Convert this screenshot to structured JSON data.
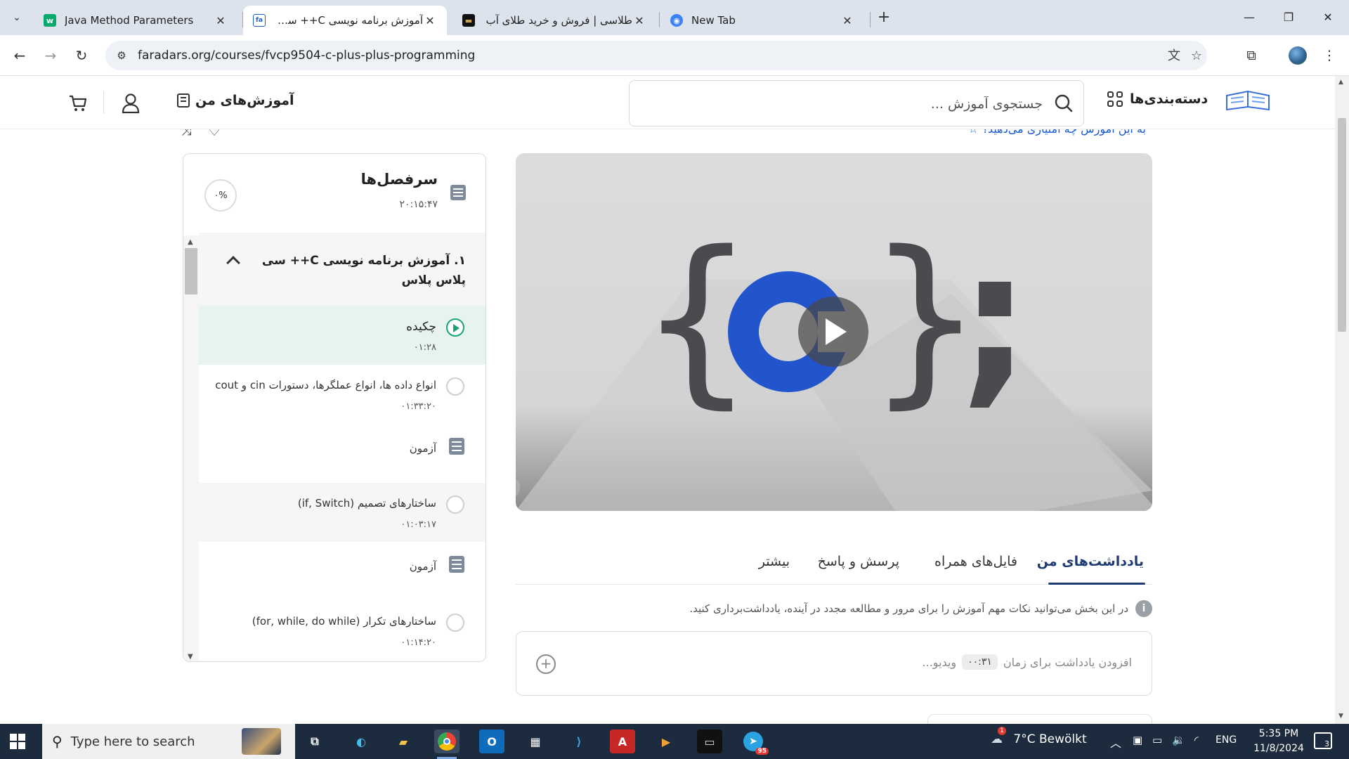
{
  "browser": {
    "tabs": [
      {
        "title": "Java Method Parameters",
        "favicon": "w3"
      },
      {
        "title": "آموزش برنامه نویسی C++ سی پلاس",
        "favicon": "faradars"
      },
      {
        "title": "طلاسی | فروش و خرید طلای آب",
        "favicon": "talasi"
      },
      {
        "title": "New Tab",
        "favicon": "chrome"
      }
    ],
    "url": "faradars.org/courses/fvcp9504-c-plus-plus-programming"
  },
  "header": {
    "categories_label": "دسته‌بندی‌ها",
    "search_placeholder": "جستجوی آموزش ...",
    "my_courses_label": "آموزش‌های من"
  },
  "peek_text": "به این آموزش چه امتیازی می‌دهید؟",
  "sidebar": {
    "title": "سرفصل‌ها",
    "total_duration": "۲۰:۱۵:۴۷",
    "progress": "۰%",
    "chapter": {
      "title": "۱. آموزش برنامه نویسی C++ سی پلاس پلاس"
    },
    "lessons": [
      {
        "type": "lesson",
        "name": "چکیده",
        "duration": "۰۱:۲۸",
        "state": "current"
      },
      {
        "type": "lesson",
        "name": "انواع داده ها، انواع عملگرها، دستورات cin و cout",
        "duration": "۰۱:۳۳:۲۰",
        "state": "normal"
      },
      {
        "type": "quiz",
        "name": "آزمون"
      },
      {
        "type": "lesson",
        "name": "ساختارهای تصمیم (if, Switch)",
        "duration": "۰۱:۰۳:۱۷",
        "state": "alt"
      },
      {
        "type": "quiz",
        "name": "آزمون"
      },
      {
        "type": "lesson",
        "name": "ساختارهای تکرار (for, while, do while)",
        "duration": "۰۱:۱۴:۲۰",
        "state": "normal"
      }
    ]
  },
  "content_tabs": {
    "notes": "یادداشت‌های من",
    "files": "فایل‌های همراه",
    "qa": "پرسش و پاسخ",
    "more": "بیشتر"
  },
  "notes": {
    "hint": "در این بخش می‌توانید نکات مهم آموزش را برای مرور و مطالعه مجدد در آینده، یادداشت‌برداری کنید.",
    "add_prefix": "افزودن یادداشت برای زمان",
    "time": "۰۰:۳۱",
    "add_suffix": "ویدیو..."
  },
  "taskbar": {
    "search_placeholder": "Type here to search",
    "weather": "7°C  Bewölkt",
    "lang": "ENG",
    "time": "5:35 PM",
    "date": "11/8/2024",
    "notifications": "3",
    "telegram_badge": "95",
    "weather_badge": "1"
  },
  "colors": {
    "accent": "#1f3b73",
    "link": "#1a5bd1",
    "current_lesson_bg": "#e6f3ee",
    "play_green": "#1aa37a"
  }
}
